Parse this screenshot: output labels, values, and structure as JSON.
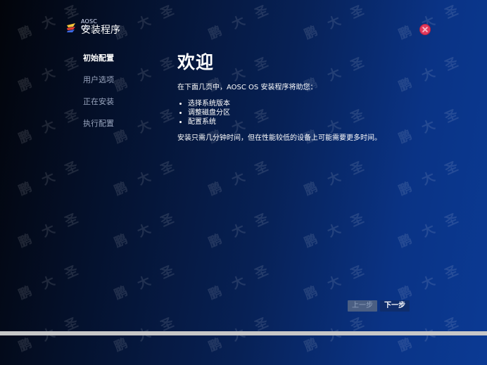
{
  "app": {
    "brand_small": "AOSC OS",
    "title": "安装程序"
  },
  "window_controls": {
    "close_icon": "close-icon"
  },
  "sidebar": {
    "steps": [
      {
        "label": "初始配置",
        "active": true
      },
      {
        "label": "用户选项",
        "active": false
      },
      {
        "label": "正在安装",
        "active": false
      },
      {
        "label": "执行配置",
        "active": false
      }
    ]
  },
  "main": {
    "title": "欢迎",
    "intro": "在下面几页中，AOSC OS 安装程序将助您：",
    "features": [
      "选择系统版本",
      "调整磁盘分区",
      "配置系统"
    ],
    "note": "安装只需几分钟时间，但在性能较低的设备上可能需要更多时间。"
  },
  "buttons": {
    "back": "上一步",
    "next": "下一步"
  },
  "watermark": {
    "text": "鹏大圣"
  },
  "colors": {
    "background_dark": "#02040a",
    "background_blue": "#0b3a94",
    "close_red": "#e3385c",
    "next_button": "#0f2d6c",
    "back_button": "#4b5f83",
    "progress_bar": "#c7c7c7"
  },
  "progress": {
    "fraction": 1.0
  }
}
